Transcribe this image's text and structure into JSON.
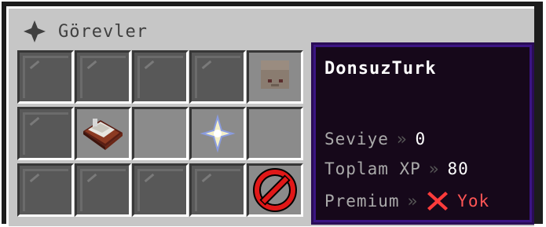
{
  "window": {
    "title": "Görevler",
    "title_icon": "compass-star-icon"
  },
  "slots": [
    {
      "row": 0,
      "col": 0,
      "item": "gray-glass-pane"
    },
    {
      "row": 0,
      "col": 1,
      "item": "gray-glass-pane"
    },
    {
      "row": 0,
      "col": 2,
      "item": "gray-glass-pane"
    },
    {
      "row": 0,
      "col": 3,
      "item": "gray-glass-pane"
    },
    {
      "row": 0,
      "col": 4,
      "item": "player-head"
    },
    {
      "row": 1,
      "col": 0,
      "item": "gray-glass-pane"
    },
    {
      "row": 1,
      "col": 1,
      "item": "enchanted-book"
    },
    {
      "row": 1,
      "col": 2,
      "item": "empty"
    },
    {
      "row": 1,
      "col": 3,
      "item": "nether-star"
    },
    {
      "row": 1,
      "col": 4,
      "item": "empty"
    },
    {
      "row": 2,
      "col": 0,
      "item": "gray-glass-pane"
    },
    {
      "row": 2,
      "col": 1,
      "item": "gray-glass-pane"
    },
    {
      "row": 2,
      "col": 2,
      "item": "gray-glass-pane"
    },
    {
      "row": 2,
      "col": 3,
      "item": "gray-glass-pane"
    },
    {
      "row": 2,
      "col": 4,
      "item": "barrier"
    }
  ],
  "tooltip": {
    "name": "DonsuzTurk",
    "separator": "»",
    "level_label": "Seviye",
    "level_value": "0",
    "xp_label": "Toplam XP",
    "xp_value": "80",
    "premium_label": "Premium",
    "premium_icon": "red-x-icon",
    "premium_value": "Yok"
  },
  "colors": {
    "tooltip_text_value": "#ffffff",
    "tooltip_label": "#aaaaaa",
    "negative": "#ff5555",
    "tooltip_border": "#3b1583"
  }
}
